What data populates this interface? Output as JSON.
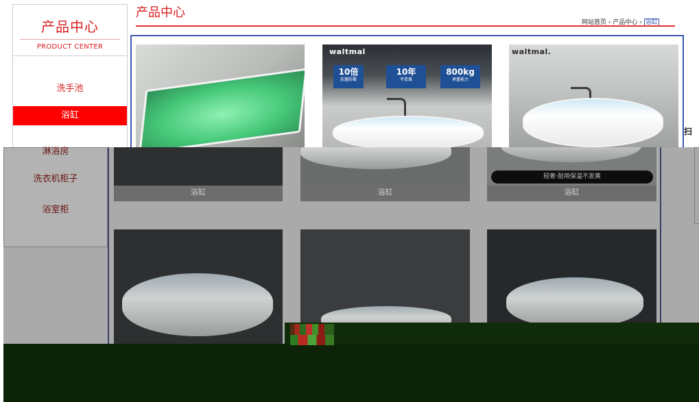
{
  "sidebar": {
    "title": "产品中心",
    "subtitle": "PRODUCT CENTER",
    "items": [
      {
        "label": "洗手池",
        "active": false
      },
      {
        "label": "浴缸",
        "active": true
      },
      {
        "label": "淋浴房",
        "active": false
      },
      {
        "label": "洗衣机柜子",
        "active": false
      },
      {
        "label": "浴室柜",
        "active": false
      }
    ]
  },
  "header": {
    "title": "产品中心",
    "breadcrumb": {
      "home": "网站首页",
      "sep1": " › ",
      "section": "产品中心",
      "sep2": " › ",
      "current": "浴缸"
    }
  },
  "products": [
    {
      "brand": "",
      "caption": "浴缸"
    },
    {
      "brand": "waltmal",
      "caption": "浴缸",
      "badges": [
        {
          "big": "10倍",
          "small": "抗菌防霉"
        },
        {
          "big": "10年",
          "small": "不变黄"
        },
        {
          "big": "800kg",
          "small": "承重能力"
        }
      ]
    },
    {
      "brand": "waltmal.",
      "caption": "浴缸",
      "pill": "轻奢·耐用保温不发黄"
    },
    {
      "brand": "",
      "caption": ""
    },
    {
      "brand": "",
      "caption": ""
    },
    {
      "brand": "",
      "caption": ""
    }
  ],
  "colors": {
    "accent_red": "#d81e1e",
    "active_bg": "#ff0000",
    "frame_blue": "#3f57b0",
    "overlay_grey": "#aaaaaa",
    "band_green": "#0d2307"
  },
  "icons": {
    "scroll_stub": "扫"
  }
}
